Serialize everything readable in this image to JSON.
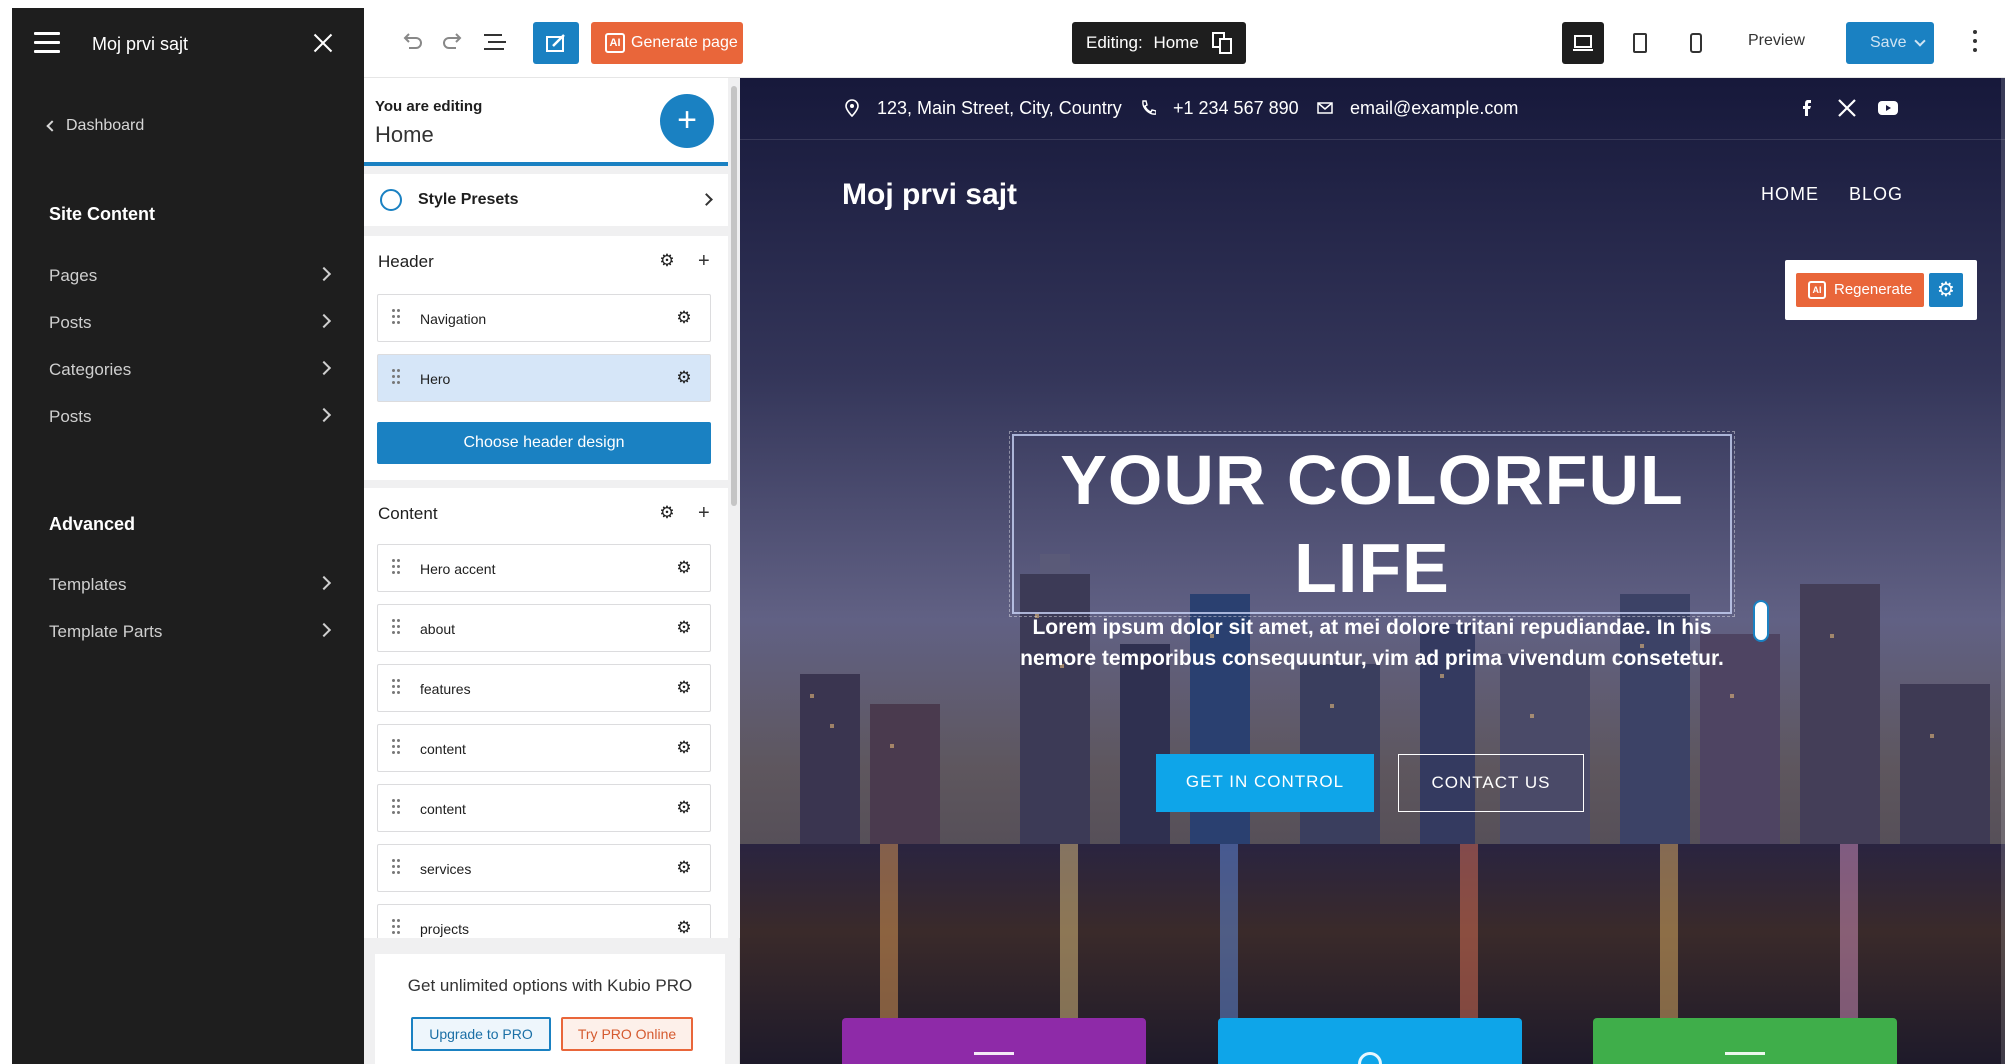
{
  "sidebar": {
    "site_title": "Moj prvi sajt",
    "dashboard_link": "Dashboard",
    "site_content_title": "Site Content",
    "items": [
      {
        "label": "Pages"
      },
      {
        "label": "Posts"
      },
      {
        "label": "Categories"
      },
      {
        "label": "Posts"
      }
    ],
    "advanced_title": "Advanced",
    "advanced_items": [
      {
        "label": "Templates"
      },
      {
        "label": "Template Parts"
      }
    ]
  },
  "toolbar": {
    "generate_label": "Generate page",
    "ai_badge": "AI",
    "editing_label": "Editing:",
    "editing_page": "Home",
    "preview_label": "Preview",
    "save_label": "Save"
  },
  "panel": {
    "you_are_editing": "You are editing",
    "page_name": "Home",
    "add_symbol": "+",
    "style_presets": "Style Presets",
    "header_group": {
      "title": "Header",
      "blocks": [
        {
          "label": "Navigation"
        },
        {
          "label": "Hero"
        }
      ],
      "choose_label": "Choose header design"
    },
    "content_group": {
      "title": "Content",
      "blocks": [
        {
          "label": "Hero accent"
        },
        {
          "label": "about"
        },
        {
          "label": "features"
        },
        {
          "label": "content"
        },
        {
          "label": "content"
        },
        {
          "label": "services"
        },
        {
          "label": "projects"
        }
      ]
    },
    "pro": {
      "text": "Get unlimited options with Kubio PRO",
      "upgrade_label": "Upgrade to PRO",
      "try_label": "Try PRO Online"
    }
  },
  "site": {
    "address": "123, Main Street, City, Country",
    "phone": "+1 234 567 890",
    "email": "email@example.com",
    "brand": "Moj prvi sajt",
    "nav": [
      {
        "label": "HOME"
      },
      {
        "label": "BLOG"
      }
    ],
    "regenerate_label": "Regenerate",
    "hero_title": "YOUR COLORFUL LIFE",
    "hero_text": "Lorem ipsum dolor sit amet, at mei dolore tritani repudiandae. In his nemore temporibus consequuntur, vim ad prima vivendum consetetur.",
    "cta_primary": "GET IN CONTROL",
    "cta_secondary": "CONTACT US"
  },
  "colors": {
    "accent_blue": "#1a81c2",
    "ai_orange": "#e9663a",
    "cta_cyan": "#0ea5e9",
    "card_purple": "#8e2aa8",
    "card_blue": "#0ea5e9",
    "card_green": "#3fae4a"
  }
}
